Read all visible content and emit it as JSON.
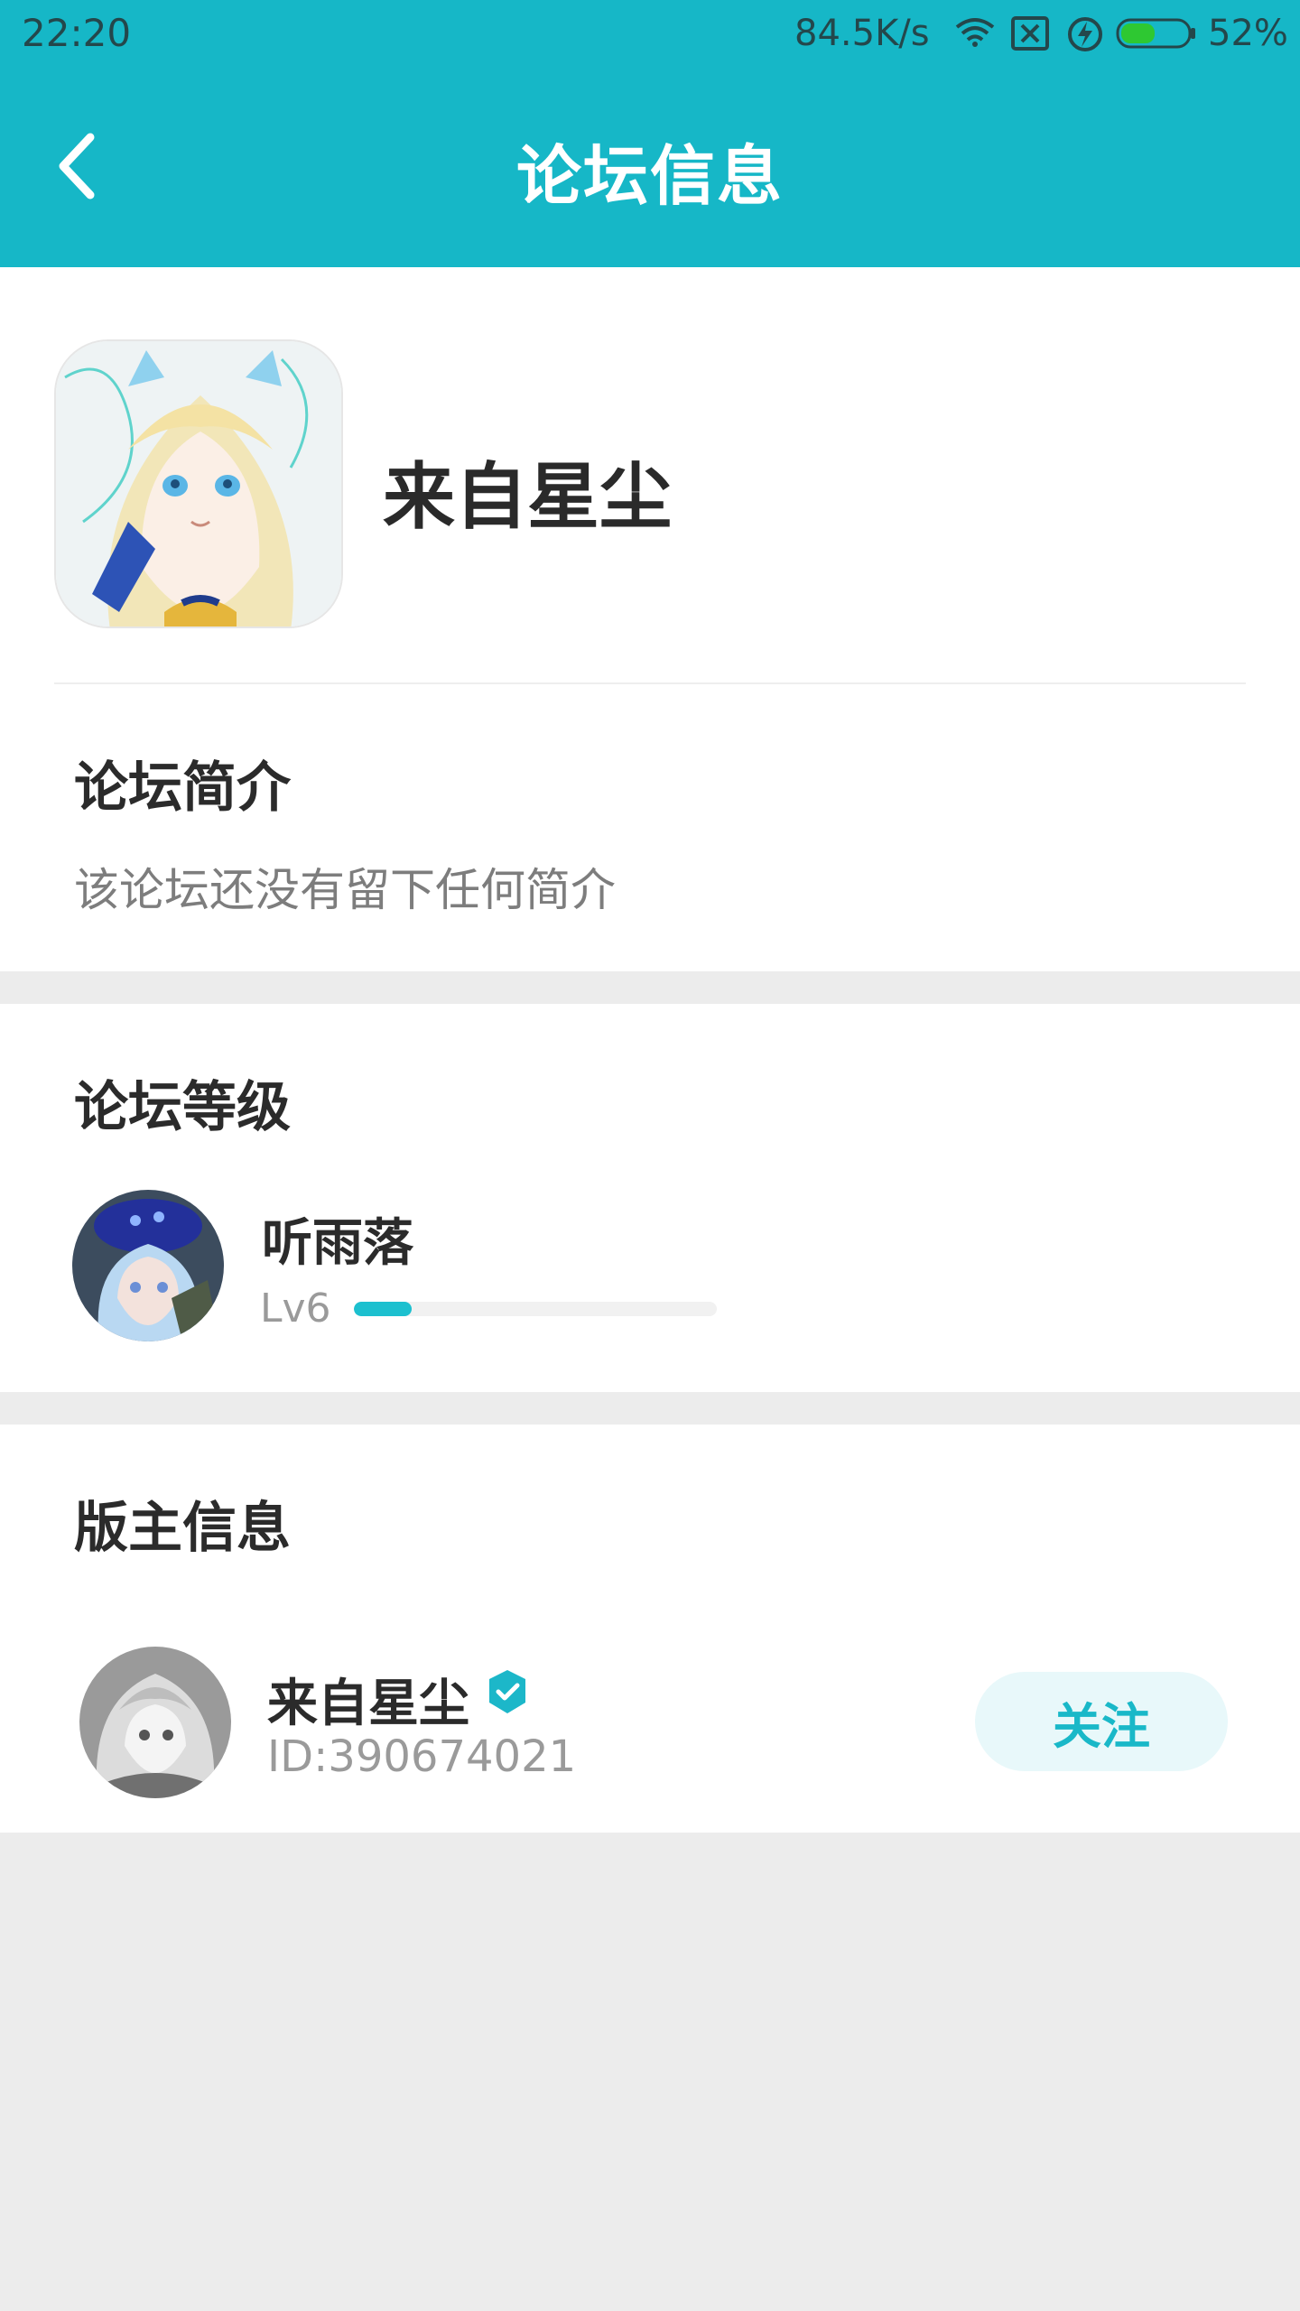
{
  "status_bar": {
    "time": "22:20",
    "network_speed": "84.5K/s",
    "battery": "52%",
    "icons": [
      "wifi-icon",
      "sim-x-icon",
      "charging-icon",
      "battery-icon"
    ],
    "battery_level": 0.52
  },
  "app_bar": {
    "back_icon": "chevron-left-icon",
    "title": "论坛信息"
  },
  "forum": {
    "name": "来自星尘",
    "logo": "anime-girl-logo"
  },
  "intro": {
    "title": "论坛简介",
    "text": "该论坛还没有留下任何简介"
  },
  "level": {
    "title": "论坛等级",
    "user_name": "听雨落",
    "level_label": "Lv6",
    "progress": 0.16
  },
  "moderator": {
    "title": "版主信息",
    "name": "来自星尘",
    "id_text": "ID:390674021",
    "verified_icon": "verified-shield-icon",
    "follow_label": "关注"
  },
  "colors": {
    "accent": "#16b7c7",
    "background": "#ececec",
    "follow_bg": "#e8f8fa"
  }
}
